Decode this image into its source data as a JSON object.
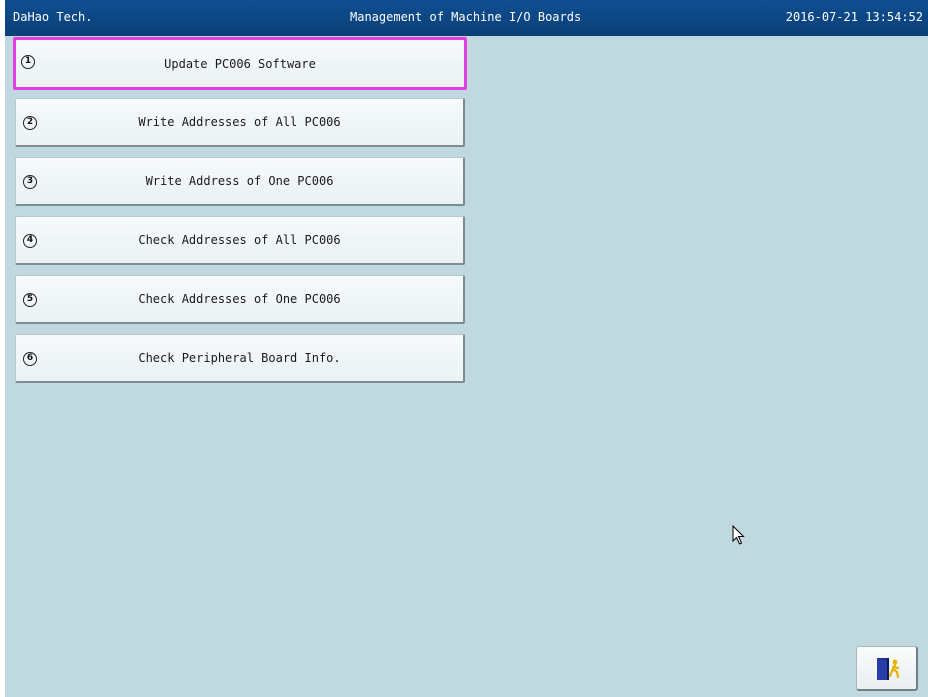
{
  "header": {
    "company": "DaHao Tech.",
    "title": "Management of Machine I/O Boards",
    "datetime": "2016-07-21 13:54:52"
  },
  "menu": {
    "items": [
      {
        "number": "1",
        "label": "Update PC006 Software",
        "selected": true
      },
      {
        "number": "2",
        "label": "Write Addresses of All PC006",
        "selected": false
      },
      {
        "number": "3",
        "label": "Write Address of One PC006",
        "selected": false
      },
      {
        "number": "4",
        "label": "Check Addresses of All PC006",
        "selected": false
      },
      {
        "number": "5",
        "label": "Check Addresses of One PC006",
        "selected": false
      },
      {
        "number": "6",
        "label": "Check Peripheral Board Info.",
        "selected": false
      }
    ]
  },
  "exit_button": {
    "icon": "exit-door-icon"
  },
  "colors": {
    "background": "#c0d9e0",
    "titlebar": "#0e4f91",
    "selection_border": "#e33ee0"
  }
}
